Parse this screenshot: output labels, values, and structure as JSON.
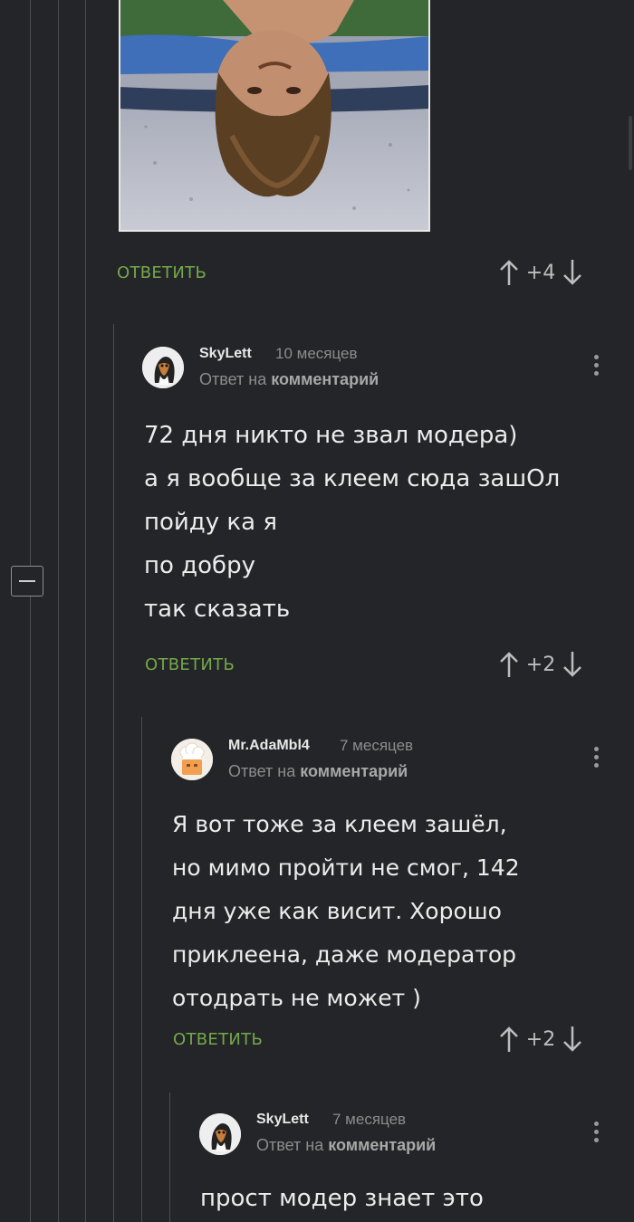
{
  "reply_label": "ОТВЕТИТЬ",
  "reply_to_prefix": "Ответ на",
  "reply_to_link": "комментарий",
  "post_comment": {
    "score": "+4"
  },
  "comments": [
    {
      "username": "SkyLett",
      "time": "10 месяцев",
      "score": "+2",
      "lines": [
        "72 дня никто не звал модера)",
        "а я вообще за клеем сюда зашОл",
        "пойду ка я",
        "по добру",
        "так сказать"
      ]
    },
    {
      "username": "Mr.AdaMbl4",
      "time": "7 месяцев",
      "score": "+2",
      "lines": [
        "Я вот тоже за клеем зашёл,",
        "но мимо пройти не смог, 142",
        "дня уже как висит. Хорошо",
        "приклеена, даже модератор",
        "отодрать не может )"
      ]
    },
    {
      "username": "SkyLett",
      "time": "7 месяцев",
      "lines": [
        "прост модер знает это"
      ]
    }
  ],
  "icons": {
    "upvote": "arrow-up-icon",
    "downvote": "arrow-down-icon",
    "menu": "more-vertical-icon",
    "collapse": "minus-square-icon"
  },
  "colors": {
    "background": "#232528",
    "accent": "#74a84a",
    "thread_line": "#4a4d52"
  }
}
